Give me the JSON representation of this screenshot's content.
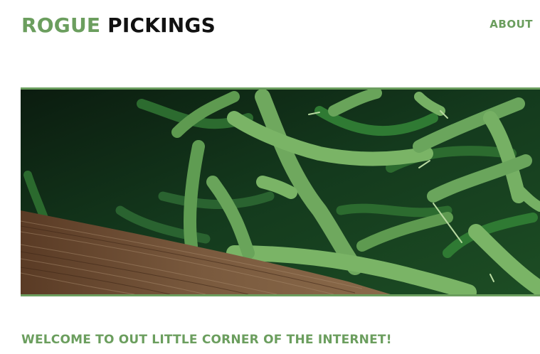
{
  "header": {
    "logo_accent": "ROGUE",
    "logo_main": "PICKINGS",
    "nav_about": "ABOUT"
  },
  "hero": {
    "image_subject": "green beans on wooden crate"
  },
  "main": {
    "welcome_heading": "WELCOME TO OUT LITTLE CORNER OF THE INTERNET!"
  },
  "colors": {
    "accent": "#6b9e5e",
    "text": "#111111",
    "background": "#ffffff"
  }
}
